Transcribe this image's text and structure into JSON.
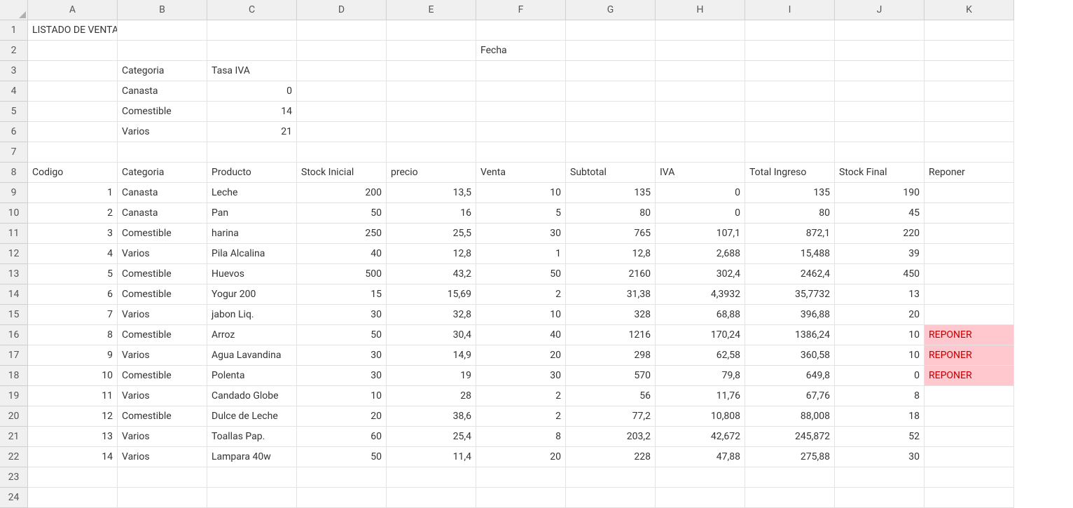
{
  "columns": [
    "A",
    "B",
    "C",
    "D",
    "E",
    "F",
    "G",
    "H",
    "I",
    "J",
    "K"
  ],
  "rows": 24,
  "title": "LISTADO DE VENTAS AUTOSERVICE",
  "fecha_label": "Fecha",
  "iva_table": {
    "headers": [
      "Categoria",
      "Tasa IVA"
    ],
    "rows": [
      {
        "cat": "Canasta",
        "tasa": "0"
      },
      {
        "cat": "Comestible",
        "tasa": "14"
      },
      {
        "cat": "Varios",
        "tasa": "21"
      }
    ]
  },
  "main_headers": [
    "Codigo",
    "Categoria",
    "Producto",
    "Stock Inicial",
    "precio",
    "Venta",
    "Subtotal",
    "IVA",
    "Total Ingreso",
    "Stock Final",
    "Reponer"
  ],
  "data": [
    {
      "codigo": "1",
      "categoria": "Canasta",
      "producto": "Leche",
      "stock_ini": "200",
      "precio": "13,5",
      "venta": "10",
      "subtotal": "135",
      "iva": "0",
      "total": "135",
      "stock_fin": "190",
      "reponer": ""
    },
    {
      "codigo": "2",
      "categoria": "Canasta",
      "producto": "Pan",
      "stock_ini": "50",
      "precio": "16",
      "venta": "5",
      "subtotal": "80",
      "iva": "0",
      "total": "80",
      "stock_fin": "45",
      "reponer": ""
    },
    {
      "codigo": "3",
      "categoria": "Comestible",
      "producto": "harina",
      "stock_ini": "250",
      "precio": "25,5",
      "venta": "30",
      "subtotal": "765",
      "iva": "107,1",
      "total": "872,1",
      "stock_fin": "220",
      "reponer": ""
    },
    {
      "codigo": "4",
      "categoria": "Varios",
      "producto": "Pila Alcalina",
      "stock_ini": "40",
      "precio": "12,8",
      "venta": "1",
      "subtotal": "12,8",
      "iva": "2,688",
      "total": "15,488",
      "stock_fin": "39",
      "reponer": ""
    },
    {
      "codigo": "5",
      "categoria": "Comestible",
      "producto": "Huevos",
      "stock_ini": "500",
      "precio": "43,2",
      "venta": "50",
      "subtotal": "2160",
      "iva": "302,4",
      "total": "2462,4",
      "stock_fin": "450",
      "reponer": ""
    },
    {
      "codigo": "6",
      "categoria": "Comestible",
      "producto": "Yogur 200",
      "stock_ini": "15",
      "precio": "15,69",
      "venta": "2",
      "subtotal": "31,38",
      "iva": "4,3932",
      "total": "35,7732",
      "stock_fin": "13",
      "reponer": ""
    },
    {
      "codigo": "7",
      "categoria": "Varios",
      "producto": "jabon Liq.",
      "stock_ini": "30",
      "precio": "32,8",
      "venta": "10",
      "subtotal": "328",
      "iva": "68,88",
      "total": "396,88",
      "stock_fin": "20",
      "reponer": ""
    },
    {
      "codigo": "8",
      "categoria": "Comestible",
      "producto": "Arroz",
      "stock_ini": "50",
      "precio": "30,4",
      "venta": "40",
      "subtotal": "1216",
      "iva": "170,24",
      "total": "1386,24",
      "stock_fin": "10",
      "reponer": "REPONER"
    },
    {
      "codigo": "9",
      "categoria": "Varios",
      "producto": "Agua Lavandina",
      "stock_ini": "30",
      "precio": "14,9",
      "venta": "20",
      "subtotal": "298",
      "iva": "62,58",
      "total": "360,58",
      "stock_fin": "10",
      "reponer": "REPONER"
    },
    {
      "codigo": "10",
      "categoria": "Comestible",
      "producto": "Polenta",
      "stock_ini": "30",
      "precio": "19",
      "venta": "30",
      "subtotal": "570",
      "iva": "79,8",
      "total": "649,8",
      "stock_fin": "0",
      "reponer": "REPONER"
    },
    {
      "codigo": "11",
      "categoria": "Varios",
      "producto": "Candado Globe",
      "stock_ini": "10",
      "precio": "28",
      "venta": "2",
      "subtotal": "56",
      "iva": "11,76",
      "total": "67,76",
      "stock_fin": "8",
      "reponer": ""
    },
    {
      "codigo": "12",
      "categoria": "Comestible",
      "producto": "Dulce de Leche",
      "stock_ini": "20",
      "precio": "38,6",
      "venta": "2",
      "subtotal": "77,2",
      "iva": "10,808",
      "total": "88,008",
      "stock_fin": "18",
      "reponer": ""
    },
    {
      "codigo": "13",
      "categoria": "Varios",
      "producto": "Toallas Pap.",
      "stock_ini": "60",
      "precio": "25,4",
      "venta": "8",
      "subtotal": "203,2",
      "iva": "42,672",
      "total": "245,872",
      "stock_fin": "52",
      "reponer": ""
    },
    {
      "codigo": "14",
      "categoria": "Varios",
      "producto": "Lampara 40w",
      "stock_ini": "50",
      "precio": "11,4",
      "venta": "20",
      "subtotal": "228",
      "iva": "47,88",
      "total": "275,88",
      "stock_fin": "30",
      "reponer": ""
    }
  ]
}
